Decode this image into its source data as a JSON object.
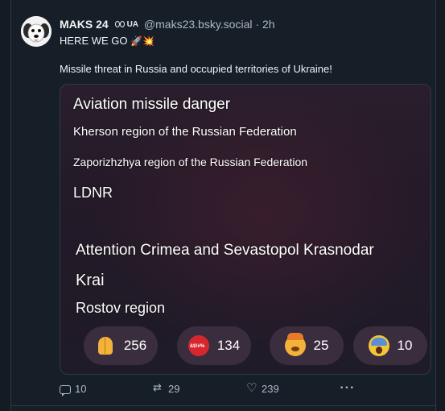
{
  "post": {
    "display_name": "MAKS 24",
    "badge_text": "UA",
    "handle": "@maks23.bsky.social",
    "separator": "·",
    "time": "2h",
    "line1": "HERE WE GO",
    "line1_emoji": "🚀💥",
    "body": "Missile threat in Russia and occupied territories of Ukraine!"
  },
  "media": {
    "lines": [
      "Aviation missile danger",
      "Kherson region of the Russian Federation",
      "Zaporizhzhya region of the Russian Federation",
      "LDNR",
      "Attention Crimea and Sevastopol Krasnodar",
      "Krai",
      "Rostov region"
    ],
    "reactions": [
      {
        "icon": "folded-hands-icon",
        "count": "256"
      },
      {
        "icon": "cursing-face-icon",
        "count": "134"
      },
      {
        "icon": "exploding-head-icon",
        "count": "25"
      },
      {
        "icon": "screaming-face-icon",
        "count": "10"
      }
    ]
  },
  "actions": {
    "replies": "10",
    "reposts": "29",
    "likes": "239"
  },
  "colors": {
    "background": "#161e27",
    "text": "#f1f3f5",
    "muted": "#aeb9c6",
    "media_bg": "#241a28",
    "reaction_pill": "#3a2e3e"
  }
}
